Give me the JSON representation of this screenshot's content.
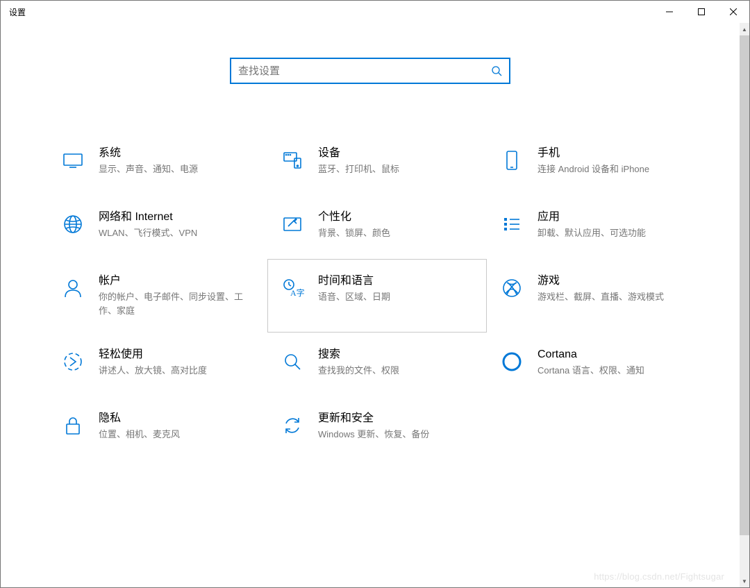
{
  "window": {
    "title": "设置"
  },
  "search": {
    "placeholder": "查找设置"
  },
  "tiles": [
    {
      "id": "system",
      "title": "系统",
      "desc": "显示、声音、通知、电源",
      "icon": "display-icon",
      "selected": false
    },
    {
      "id": "devices",
      "title": "设备",
      "desc": "蓝牙、打印机、鼠标",
      "icon": "devices-icon",
      "selected": false
    },
    {
      "id": "phone",
      "title": "手机",
      "desc": "连接 Android 设备和 iPhone",
      "icon": "phone-icon",
      "selected": false
    },
    {
      "id": "network",
      "title": "网络和 Internet",
      "desc": "WLAN、飞行模式、VPN",
      "icon": "globe-icon",
      "selected": false
    },
    {
      "id": "personalize",
      "title": "个性化",
      "desc": "背景、锁屏、颜色",
      "icon": "personalize-icon",
      "selected": false
    },
    {
      "id": "apps",
      "title": "应用",
      "desc": "卸载、默认应用、可选功能",
      "icon": "apps-list-icon",
      "selected": false
    },
    {
      "id": "accounts",
      "title": "帐户",
      "desc": "你的帐户、电子邮件、同步设置、工作、家庭",
      "icon": "person-icon",
      "selected": false
    },
    {
      "id": "time-language",
      "title": "时间和语言",
      "desc": "语音、区域、日期",
      "icon": "time-language-icon",
      "selected": true
    },
    {
      "id": "gaming",
      "title": "游戏",
      "desc": "游戏栏、截屏、直播、游戏模式",
      "icon": "xbox-icon",
      "selected": false
    },
    {
      "id": "ease-of-access",
      "title": "轻松使用",
      "desc": "讲述人、放大镜、高对比度",
      "icon": "ease-of-access-icon",
      "selected": false
    },
    {
      "id": "search",
      "title": "搜索",
      "desc": "查找我的文件、权限",
      "icon": "search-icon",
      "selected": false
    },
    {
      "id": "cortana",
      "title": "Cortana",
      "desc": "Cortana 语言、权限、通知",
      "icon": "cortana-icon",
      "selected": false
    },
    {
      "id": "privacy",
      "title": "隐私",
      "desc": "位置、相机、麦克风",
      "icon": "lock-icon",
      "selected": false
    },
    {
      "id": "update",
      "title": "更新和安全",
      "desc": "Windows 更新、恢复、备份",
      "icon": "update-icon",
      "selected": false
    }
  ],
  "watermark": "https://blog.csdn.net/Fightsugar"
}
